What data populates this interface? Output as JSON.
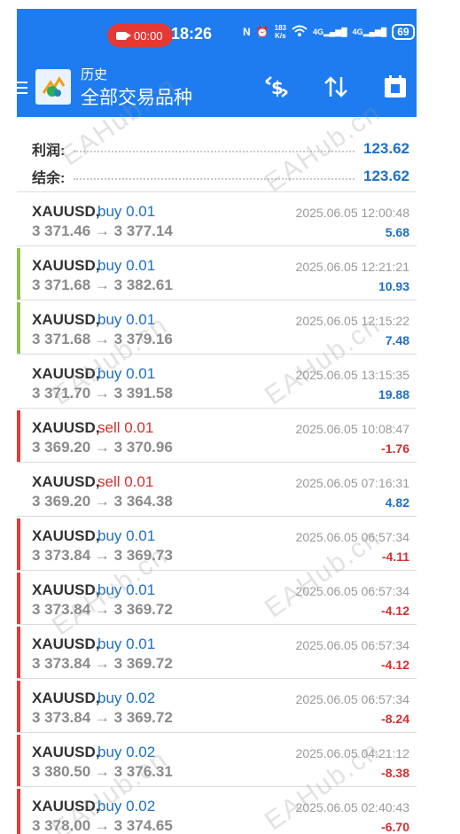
{
  "status_bar": {
    "record_time": "00:00",
    "clock": "18:26",
    "net_speed_top": "183",
    "net_speed_unit": "K/s",
    "network_a": "4G",
    "network_b": "4G",
    "battery": "69"
  },
  "header": {
    "subtitle": "历史",
    "title": "全部交易品种"
  },
  "summary": {
    "profit_label": "利润:",
    "profit_value": "123.62",
    "balance_label": "结余:",
    "balance_value": "123.62"
  },
  "deals": [
    {
      "symbol": "XAUUSD,",
      "side": "buy 0.01",
      "prices": "3 371.46 → 3 377.14",
      "time": "2025.06.05 12:00:48",
      "profit": "5.68"
    },
    {
      "symbol": "XAUUSD,",
      "side": "buy 0.01",
      "prices": "3 371.68 → 3 382.61",
      "time": "2025.06.05 12:21:21",
      "profit": "10.93"
    },
    {
      "symbol": "XAUUSD,",
      "side": "buy 0.01",
      "prices": "3 371.68 → 3 379.16",
      "time": "2025.06.05 12:15:22",
      "profit": "7.48"
    },
    {
      "symbol": "XAUUSD,",
      "side": "buy 0.01",
      "prices": "3 371.70 → 3 391.58",
      "time": "2025.06.05 13:15:35",
      "profit": "19.88"
    },
    {
      "symbol": "XAUUSD,",
      "side": "sell 0.01",
      "prices": "3 369.20 → 3 370.96",
      "time": "2025.06.05 10:08:47",
      "profit": "-1.76"
    },
    {
      "symbol": "XAUUSD,",
      "side": "sell 0.01",
      "prices": "3 369.20 → 3 364.38",
      "time": "2025.06.05 07:16:31",
      "profit": "4.82"
    },
    {
      "symbol": "XAUUSD,",
      "side": "buy 0.01",
      "prices": "3 373.84 → 3 369.73",
      "time": "2025.06.05 06:57:34",
      "profit": "-4.11"
    },
    {
      "symbol": "XAUUSD,",
      "side": "buy 0.01",
      "prices": "3 373.84 → 3 369.72",
      "time": "2025.06.05 06:57:34",
      "profit": "-4.12"
    },
    {
      "symbol": "XAUUSD,",
      "side": "buy 0.01",
      "prices": "3 373.84 → 3 369.72",
      "time": "2025.06.05 06:57:34",
      "profit": "-4.12"
    },
    {
      "symbol": "XAUUSD,",
      "side": "buy 0.02",
      "prices": "3 373.84 → 3 369.72",
      "time": "2025.06.05 06:57:34",
      "profit": "-8.24"
    },
    {
      "symbol": "XAUUSD,",
      "side": "buy 0.02",
      "prices": "3 380.50 → 3 376.31",
      "time": "2025.06.05 04:21:12",
      "profit": "-8.38"
    },
    {
      "symbol": "XAUUSD,",
      "side": "buy 0.02",
      "prices": "3 378.00 → 3 374.65",
      "time": "2025.06.05 02:40:43",
      "profit": "-6.70"
    }
  ],
  "watermark": "EAHub.cn",
  "colors": {
    "app_bar": "#1E7CF0",
    "buy": "#1f6fc4",
    "sell": "#d32f2f",
    "profit_positive": "#1f6fc4",
    "profit_negative": "#d32f2f",
    "bar_green": "#8BC34A",
    "bar_red": "#E53935"
  }
}
